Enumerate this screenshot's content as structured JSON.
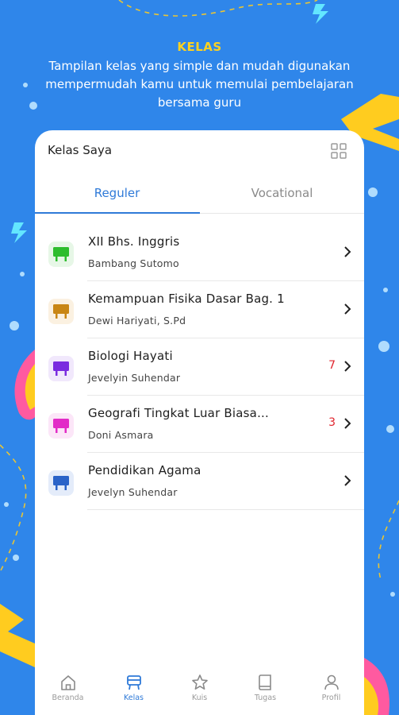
{
  "hero": {
    "title": "KELAS",
    "subtitle": "Tampilan kelas yang simple dan mudah digunakan mempermudah kamu untuk memulai pembelajaran bersama guru"
  },
  "card": {
    "title": "Kelas Saya",
    "tabs": [
      {
        "label": "Reguler",
        "active": true
      },
      {
        "label": "Vocational",
        "active": false
      }
    ]
  },
  "classes": [
    {
      "name": "XII Bhs. Inggris",
      "teacher": "Bambang Sutomo",
      "badge": "",
      "color": "#2ebd2e",
      "bg": "#e7f7e7"
    },
    {
      "name": "Kemampuan Fisika Dasar Bag. 1",
      "teacher": "Dewi Hariyati, S.Pd",
      "badge": "",
      "color": "#c98614",
      "bg": "#fbf1e1"
    },
    {
      "name": "Biologi Hayati",
      "teacher": "Jevelyin Suhendar",
      "badge": "7",
      "color": "#7a2be0",
      "bg": "#f1e8fc"
    },
    {
      "name": "Geografi Tingkat Luar Biasa...",
      "teacher": "Doni Asmara",
      "badge": "3",
      "color": "#e22cc7",
      "bg": "#fce6f8"
    },
    {
      "name": "Pendidikan Agama",
      "teacher": "Jevelyn Suhendar",
      "badge": "",
      "color": "#2a63c8",
      "bg": "#e4ecfa"
    }
  ],
  "nav": [
    {
      "label": "Beranda",
      "icon": "home-icon",
      "active": false
    },
    {
      "label": "Kelas",
      "icon": "class-icon",
      "active": true
    },
    {
      "label": "Kuis",
      "icon": "star-icon",
      "active": false
    },
    {
      "label": "Tugas",
      "icon": "book-icon",
      "active": false
    },
    {
      "label": "Profil",
      "icon": "user-icon",
      "active": false
    }
  ],
  "colors": {
    "background": "#2f86ea",
    "accent": "#2f7ad8",
    "hero_title": "#ffd21f",
    "badge": "#e0242d"
  }
}
